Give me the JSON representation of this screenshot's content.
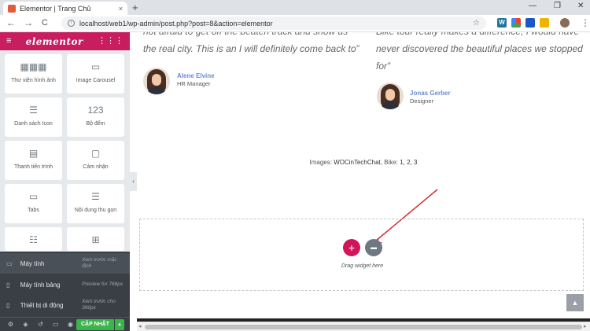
{
  "browser": {
    "tab_title": "Elementor | Trang Chủ",
    "tab_close": "×",
    "new_tab": "+",
    "url": "localhost/web1/wp-admin/post.php?post=8&action=elementor",
    "back": "←",
    "forward": "→",
    "reload": "C",
    "star": "☆",
    "minimize": "—",
    "maximize": "❐",
    "close": "✕",
    "menu": "⋮"
  },
  "panel": {
    "logo": "elementor",
    "menu_icon": "≡",
    "grid_icon": "⋮⋮⋮",
    "widgets": [
      {
        "icon": "▦▦▦",
        "label": "Thư viện hình ảnh"
      },
      {
        "icon": "▭",
        "label": "Image Carousel"
      },
      {
        "icon": "☰",
        "label": "Danh sách Icon"
      },
      {
        "icon": "123",
        "label": "Bộ đếm"
      },
      {
        "icon": "▤",
        "label": "Thanh tiến trình"
      },
      {
        "icon": "▢",
        "label": "Cảm nhận"
      },
      {
        "icon": "▭",
        "label": "Tabs"
      },
      {
        "icon": "☰",
        "label": "Nội dung thu gọn"
      },
      {
        "icon": "☷",
        "label": ""
      },
      {
        "icon": "⊞",
        "label": ""
      }
    ],
    "responsive": [
      {
        "icon": "▭",
        "name": "Máy tính",
        "desc": "Xem trước mặc định"
      },
      {
        "icon": "▯",
        "name": "Máy tính bảng",
        "desc": "Preview for 768px"
      },
      {
        "icon": "▯",
        "name": "Thiết bị di động",
        "desc": "Xem trước cho 360px"
      }
    ],
    "footer_icons": [
      "⚙",
      "◈",
      "↺",
      "▭",
      "◉"
    ],
    "update_label": "CẬP NHẬT",
    "update_caret": "▲",
    "collapse": "‹"
  },
  "canvas": {
    "quote_left_line1": "not afraid to get off the beaten track and show us",
    "quote_left_line2": "the real city. This is an I will definitely come back to”",
    "quote_right_line1": "Bike tour really makes a difference, I would have",
    "quote_right_line2": "never discovered the beautiful places we stopped",
    "quote_right_line3": "for”",
    "person1_name": "Alene Elvine",
    "person1_role": "HR Manager",
    "person2_name": "Jonas Gerber",
    "person2_role": "Designer",
    "images_prefix": "Images: ",
    "images_source": "WOCinTechChat",
    "images_mid": ", Bike: ",
    "images_nums": "1, 2, 3",
    "add_icon": "+",
    "folder_icon": "▬",
    "drag_text": "Drag widget here",
    "scroll_top_icon": "▲"
  },
  "colors": {
    "elementor_pink": "#c81d5f",
    "add_button": "#d1155b",
    "update_green": "#39b54a",
    "panel_dark": "#3a3f45",
    "link_blue": "#6b8bd6"
  }
}
